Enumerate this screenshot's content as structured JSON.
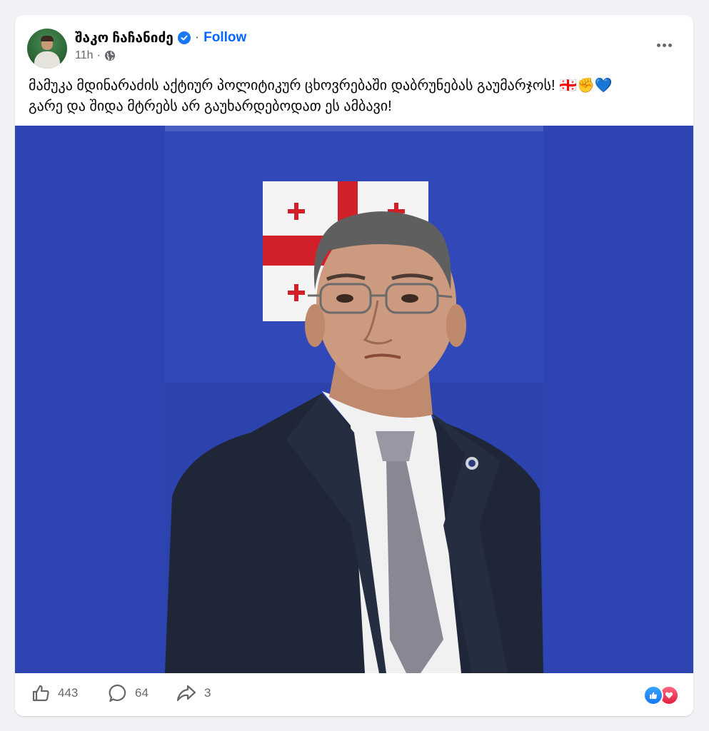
{
  "post": {
    "author": "შაკო ჩაჩანიძე",
    "follow_label": "Follow",
    "time": "11h",
    "text_line1": "მამუკა მდინარაძის აქტიურ პოლიტიკურ ცხოვრებაში დაბრუნებას გაუმარჯოს!",
    "text_line1_emojis": "🇬🇪✊💙",
    "text_line2": "გარე და შიდა მტრებს არ გაუხარდებოდათ ეს ამბავი!",
    "audience_icon": "globe-icon"
  },
  "stats": {
    "likes": "443",
    "comments": "64",
    "shares": "3"
  },
  "colors": {
    "accent": "#0866ff",
    "photo_background": "#2f44b3",
    "like_reaction": "#1877f2",
    "love_reaction": "#e41e3f"
  }
}
